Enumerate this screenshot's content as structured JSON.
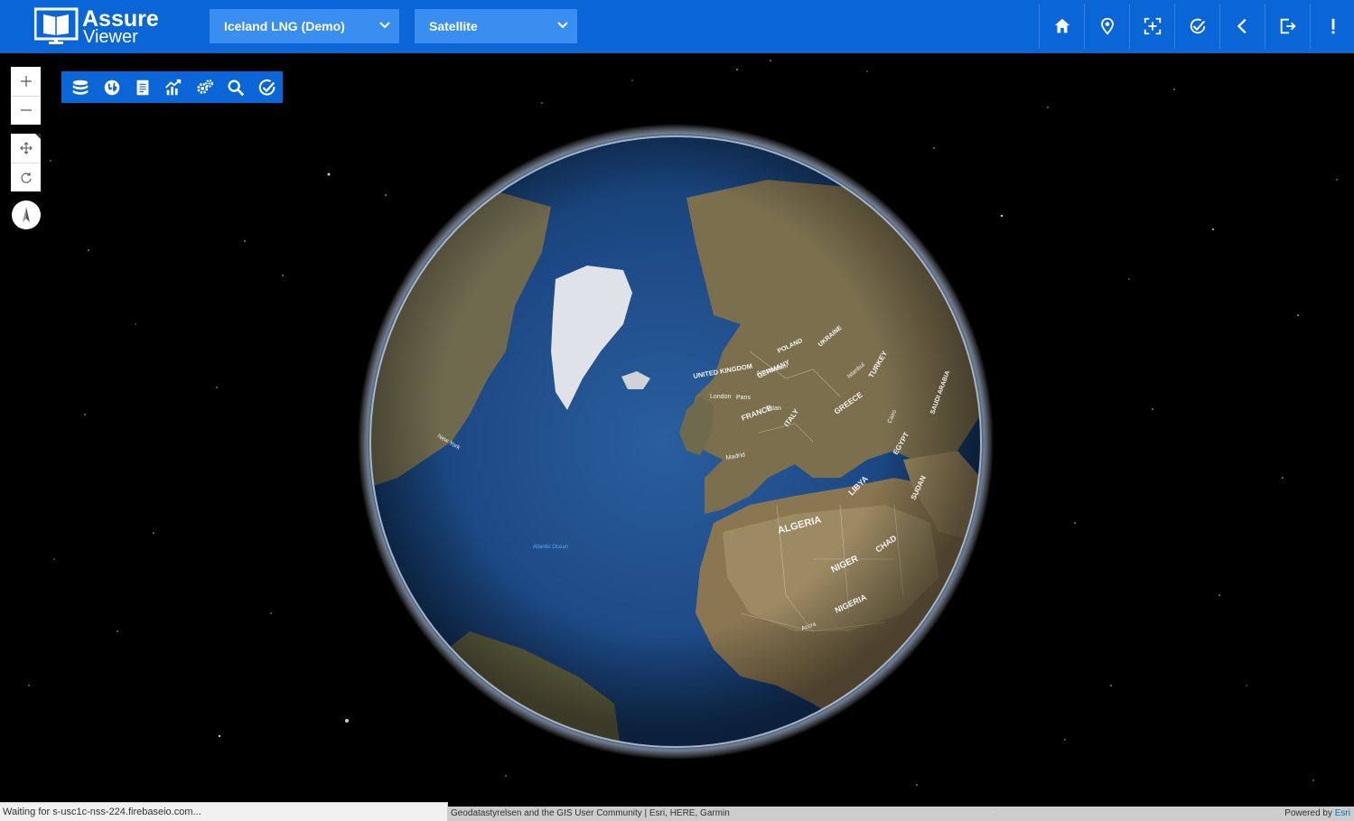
{
  "header": {
    "logo": {
      "line1": "Assure",
      "line2": "Viewer"
    },
    "project_select": {
      "value": "Iceland LNG (Demo)"
    },
    "basemap_select": {
      "value": "Satellite"
    },
    "buttons": [
      {
        "icon": "home-icon"
      },
      {
        "icon": "map-pin-icon"
      },
      {
        "icon": "add-frame-icon"
      },
      {
        "icon": "check-sync-icon"
      },
      {
        "icon": "chevron-left-icon"
      },
      {
        "icon": "logout-icon"
      },
      {
        "icon": "alert-icon"
      }
    ]
  },
  "map_controls": {
    "zoom_in": "+",
    "zoom_out": "–",
    "pan_icon": "move-icon",
    "rotate_icon": "rotate-icon",
    "compass_icon": "compass-icon"
  },
  "toolbar": {
    "icons": [
      "layers-icon",
      "globe-icon",
      "document-icon",
      "chart-icon",
      "settings-icon",
      "search-icon",
      "check-circle-icon"
    ]
  },
  "map": {
    "country_labels": [
      "UNITED KINGDOM",
      "GERMANY",
      "POLAND",
      "UKRAINE",
      "FRANCE",
      "ITALY",
      "GREECE",
      "TURKEY",
      "LIBYA",
      "EGYPT",
      "SUDAN",
      "SAUDI ARABIA",
      "ALGERIA",
      "NIGER",
      "CHAD",
      "NIGERIA"
    ],
    "city_labels": [
      "London",
      "Paris",
      "Amsterdam",
      "Madrid",
      "Milan",
      "Istanbul",
      "Cairo",
      "New York",
      "Accra"
    ],
    "ocean_label": "Atlantic Ocean",
    "colors": {
      "ocean": "#1d4a86",
      "land": "#7a6e4e",
      "ice": "#e4e6ea",
      "space": "#000000"
    }
  },
  "status": {
    "loading_text": "Waiting for s-usc1c-nss-224.firebaseio.com...",
    "attribution": "Geodatastyrelsen and the GIS User Community | Esri, HERE, Garmin",
    "powered_by": "Powered by ",
    "esri": "Esri"
  },
  "colors": {
    "header": "#0a66d6",
    "select": "#3a8ef0"
  }
}
